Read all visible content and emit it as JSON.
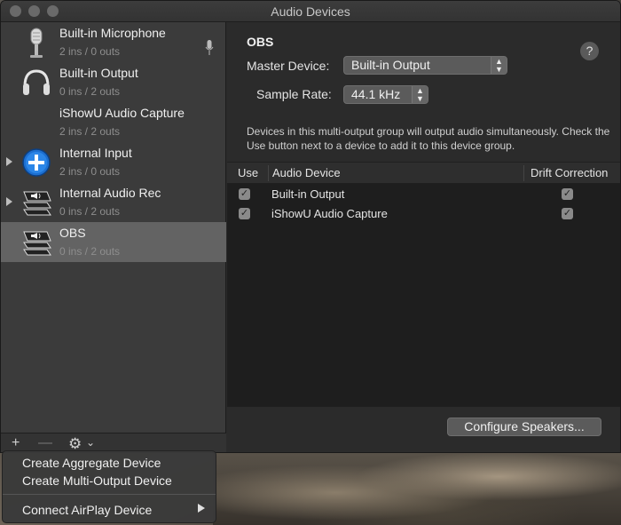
{
  "window": {
    "title": "Audio Devices"
  },
  "devices": [
    {
      "name": "Built-in Microphone",
      "sub": "2 ins / 0 outs",
      "icon": "microphone-icon"
    },
    {
      "name": "Built-in Output",
      "sub": "0 ins / 2 outs",
      "icon": "headphones-icon"
    },
    {
      "name": "iShowU Audio Capture",
      "sub": "2 ins / 2 outs",
      "icon": ""
    },
    {
      "name": "Internal Input",
      "sub": "2 ins / 0 outs",
      "icon": "plus-circle-icon"
    },
    {
      "name": "Internal Audio Rec",
      "sub": "0 ins / 2 outs",
      "icon": "multi-output-icon"
    },
    {
      "name": "OBS",
      "sub": "0 ins / 2 outs",
      "icon": "multi-output-icon"
    }
  ],
  "detail": {
    "title": "OBS",
    "master_label": "Master Device:",
    "master_value": "Built-in Output",
    "rate_label": "Sample Rate:",
    "rate_value": "44.1 kHz",
    "help": "?",
    "description": "Devices in this multi-output group will output audio simultaneously. Check the Use button next to a device to add it to this device group.",
    "columns": {
      "use": "Use",
      "device": "Audio Device",
      "drift": "Drift Correction"
    },
    "rows": [
      {
        "device": "Built-in Output",
        "use": true,
        "drift": true
      },
      {
        "device": "iShowU Audio Capture",
        "use": true,
        "drift": true
      }
    ],
    "configure_button": "Configure Speakers..."
  },
  "toolbar": {
    "add": "+",
    "remove": "—",
    "gear": "⚙︎",
    "gear_caret": "⌄"
  },
  "menu": {
    "items": [
      "Create Aggregate Device",
      "Create Multi-Output Device",
      "Connect AirPlay Device"
    ]
  },
  "colors": {
    "selected_row": "#636363",
    "window_bg": "#2b2b2b",
    "sidebar_bg": "#3b3b3b"
  }
}
